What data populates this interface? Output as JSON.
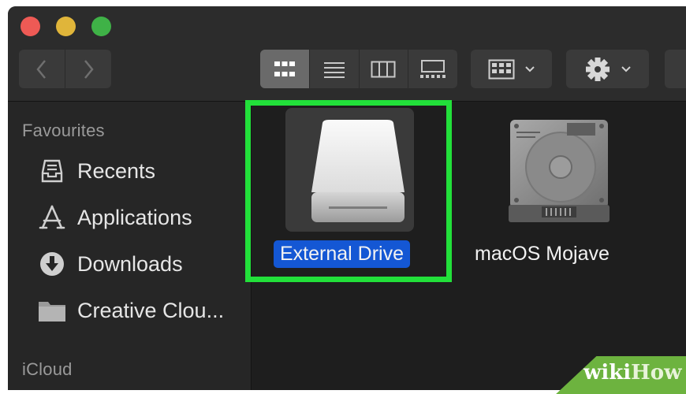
{
  "window": {
    "controls": {
      "close": "close",
      "minimize": "minimize",
      "zoom": "zoom"
    }
  },
  "toolbar": {
    "nav": {
      "back_icon": "chevron-left-icon",
      "forward_icon": "chevron-right-icon"
    },
    "views": [
      {
        "icon": "icon-view-icon",
        "active": true
      },
      {
        "icon": "list-view-icon",
        "active": false
      },
      {
        "icon": "column-view-icon",
        "active": false
      },
      {
        "icon": "gallery-view-icon",
        "active": false
      }
    ],
    "group_icon": "group-grid-icon",
    "action_icon": "gear-icon"
  },
  "sidebar": {
    "favourites_header": "Favourites",
    "items": [
      {
        "label": "Recents",
        "icon": "recents-icon"
      },
      {
        "label": "Applications",
        "icon": "applications-icon"
      },
      {
        "label": "Downloads",
        "icon": "download-icon"
      },
      {
        "label": "Creative Clou...",
        "icon": "folder-icon"
      }
    ],
    "icloud_header": "iCloud"
  },
  "content": {
    "items": [
      {
        "label": "External Drive",
        "selected": true,
        "icon": "external-drive-icon"
      },
      {
        "label": "macOS Mojave",
        "selected": false,
        "icon": "hard-disk-icon"
      }
    ]
  },
  "colors": {
    "highlight_border": "#22e03a",
    "selection": "#1457d4",
    "watermark": "#6db33f"
  },
  "watermark": {
    "wiki": "wiki",
    "how": "How"
  }
}
